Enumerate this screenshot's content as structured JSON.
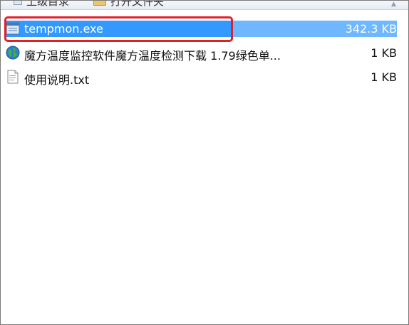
{
  "toolbar": {
    "up_label": "上级目录",
    "open_label": "打开文件夹"
  },
  "files": [
    {
      "name": "tempmon.exe",
      "size": "342.3 KB",
      "icon": "exe-file-icon",
      "selected": true
    },
    {
      "name": "魔方温度监控软件魔方温度检测下载 1.79绿色单...",
      "size": "1 KB",
      "icon": "internet-shortcut-icon",
      "selected": false
    },
    {
      "name": "使用说明.txt",
      "size": "1 KB",
      "icon": "text-file-icon",
      "selected": false
    }
  ],
  "colors": {
    "selection": "#3399ff",
    "highlight_border": "#e2202a"
  }
}
